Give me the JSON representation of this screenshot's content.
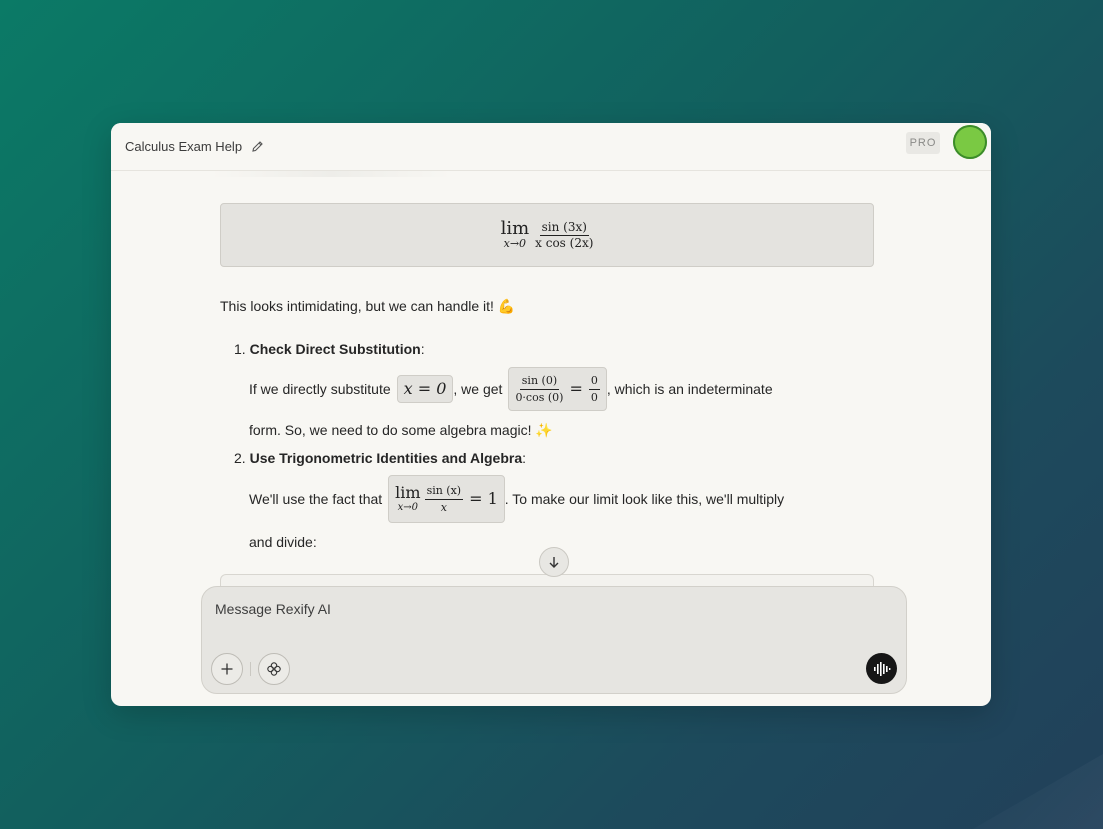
{
  "header": {
    "title": "Calculus Exam Help",
    "badge": "PRO"
  },
  "math_block": {
    "lim_word": "lim",
    "lim_sub": "x→0",
    "numerator": "sin (3x)",
    "denominator": "x cos (2x)"
  },
  "intro": {
    "text": "This looks intimidating, but we can handle it! 💪"
  },
  "steps": [
    {
      "number": "1.",
      "title": "Check Direct Substitution",
      "colon": ":",
      "line1_a": "If we directly substitute",
      "math_sub": "x = 0",
      "line1_b": ", we get",
      "frac_num": "sin (0)",
      "frac_den": "0·cos (0)",
      "eq": "=",
      "zero_num": "0",
      "zero_den": "0",
      "line1_c": ", which is an indeterminate",
      "line2": "form. So, we need to do some algebra magic! ✨"
    },
    {
      "number": "2.",
      "title": "Use Trigonometric Identities and Algebra",
      "colon": ":",
      "line1_a": "We'll use the fact that",
      "lim_word": "lim",
      "lim_sub": "x→0",
      "frac_num": "sin (x)",
      "frac_den": "x",
      "eq_one": "= 1",
      "line1_b": ". To make our limit look like this, we'll multiply",
      "line2": "and divide:"
    }
  ],
  "composer": {
    "placeholder": "Message Rexify AI"
  },
  "colors": {
    "accent_avatar": "#7ac943",
    "voice_button": "#161616"
  },
  "icons": [
    "edit-icon",
    "arrow-down-icon",
    "plus-icon",
    "flower-icon",
    "waveform-icon"
  ]
}
